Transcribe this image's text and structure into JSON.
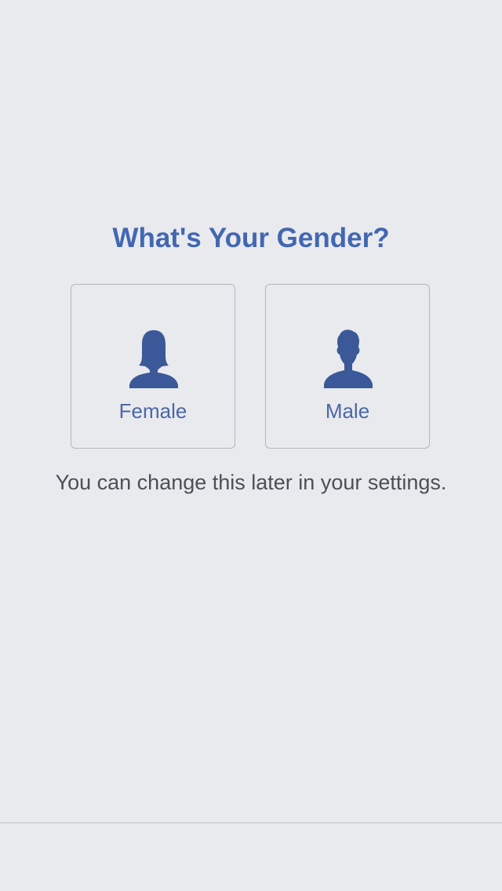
{
  "page": {
    "title": "What's Your Gender?",
    "hint": "You can change this later in your settings."
  },
  "options": {
    "female": {
      "label": "Female",
      "icon": "female-silhouette-icon"
    },
    "male": {
      "label": "Male",
      "icon": "male-silhouette-icon"
    }
  },
  "colors": {
    "background": "#e9eaee",
    "accent": "#4267b2",
    "icon": "#3b5998",
    "hint_text": "#4b4f56",
    "border": "#b4b6bb"
  }
}
